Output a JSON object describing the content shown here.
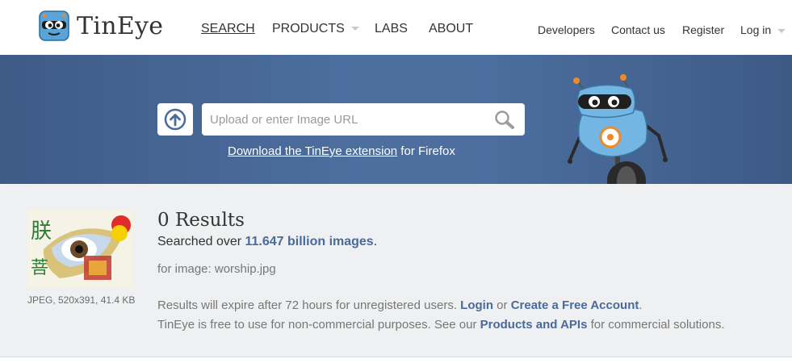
{
  "brand": {
    "name": "TinEye"
  },
  "nav": {
    "main": [
      "SEARCH",
      "PRODUCTS",
      "LABS",
      "ABOUT"
    ],
    "right": [
      "Developers",
      "Contact us",
      "Register",
      "Log in"
    ]
  },
  "search": {
    "placeholder": "Upload or enter Image URL",
    "extension_link": "Download the TinEye extension",
    "extension_suffix": " for Firefox"
  },
  "results": {
    "count_text": "0 Results",
    "searched_prefix": "Searched over ",
    "searched_amount": "11.647 billion images",
    "searched_suffix": ".",
    "for_image": "for image: worship.jpg",
    "image_meta": "JPEG, 520x391, 41.4 KB",
    "expire_text": "Results will expire after 72 hours for unregistered users. ",
    "login_link": "Login",
    "or_text": " or ",
    "create_link": "Create a Free Account",
    "period": ".",
    "free_text": "TinEye is free to use for non-commercial purposes. See our ",
    "products_link": "Products and APIs",
    "free_suffix": " for commercial solutions."
  },
  "colors": {
    "hero": "#4c6fa0",
    "link": "#4a6a9b",
    "results_bg": "#eef0f1"
  },
  "icons": [
    "tineye-logo-icon",
    "upload-icon",
    "search-icon",
    "caret-down-icon",
    "robot-mascot"
  ]
}
